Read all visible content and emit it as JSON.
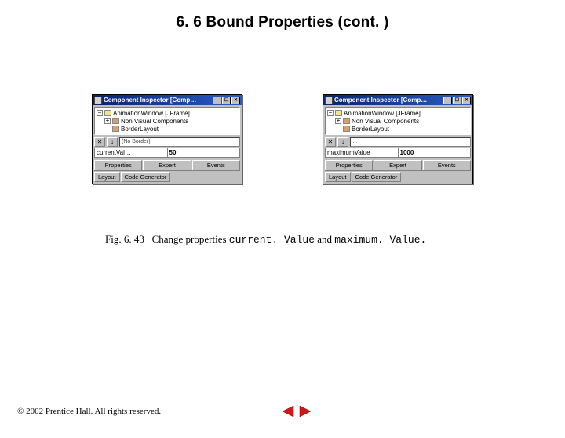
{
  "heading": "6. 6   Bound Properties (cont. )",
  "caption": {
    "fig": "Fig. 6. 43",
    "gap": "   ",
    "t1": "Change properties ",
    "c1": "current. Value",
    "t2": " and ",
    "c2": "maximum. Value."
  },
  "copyright": "© 2002 Prentice Hall.  All rights reserved.",
  "panelA": {
    "title": "Component Inspector [Comp…",
    "tree": [
      {
        "toggle": "−",
        "label": "AnimationWindow [JFrame]"
      },
      {
        "toggle": "+",
        "label": "Non Visual Components"
      },
      {
        "toggle": "",
        "label": "BorderLayout"
      }
    ],
    "dropValue": "(No Border)",
    "propName": "currentVal…",
    "propValue": "50",
    "mainTabs": [
      "Properties",
      "Expert",
      "Events"
    ],
    "subTabs": [
      "Layout",
      "Code Generator"
    ]
  },
  "panelB": {
    "title": "Component Inspector [Comp…",
    "tree": [
      {
        "toggle": "−",
        "label": "AnimationWindow [JFrame]"
      },
      {
        "toggle": "+",
        "label": "Non Visual Components"
      },
      {
        "toggle": "",
        "label": "BorderLayout"
      }
    ],
    "dropValue": "…",
    "propName": "maximumValue",
    "propValue": "1000",
    "mainTabs": [
      "Properties",
      "Expert",
      "Events"
    ],
    "subTabs": [
      "Layout",
      "Code Generator"
    ]
  },
  "icons": {
    "del": "✕",
    "arrow": "↕"
  }
}
